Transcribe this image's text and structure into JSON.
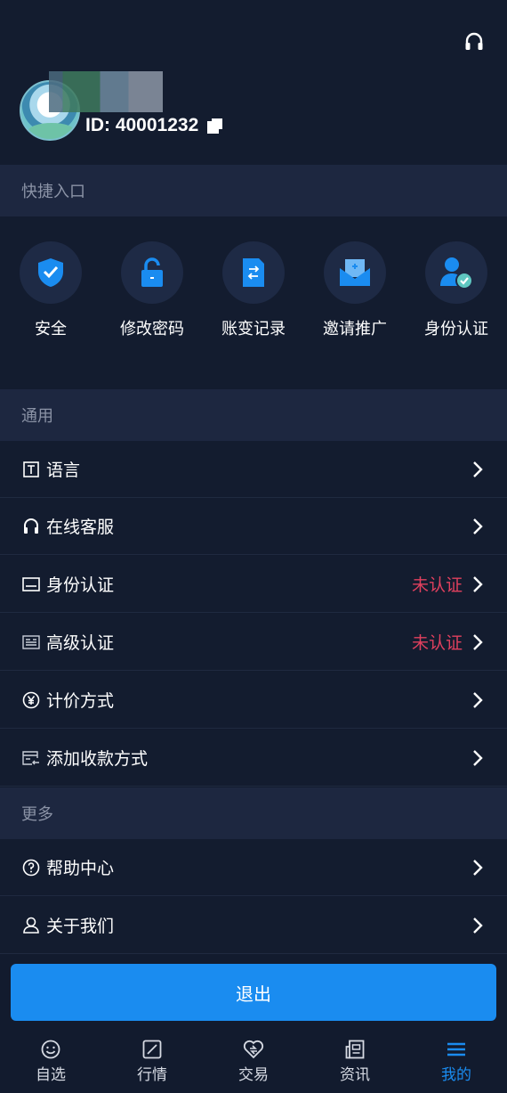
{
  "header": {
    "user_id": "ID:  40001232"
  },
  "sections": {
    "quick": "快捷入口",
    "general": "通用",
    "more": "更多"
  },
  "quick_items": [
    {
      "label": "安全",
      "icon": "shield-check-icon"
    },
    {
      "label": "修改密码",
      "icon": "lock-icon"
    },
    {
      "label": "账变记录",
      "icon": "document-transfer-icon"
    },
    {
      "label": "邀请推广",
      "icon": "envelope-icon"
    },
    {
      "label": "身份认证",
      "icon": "user-verified-icon"
    }
  ],
  "menu": {
    "language": "语言",
    "support": "在线客服",
    "identity": "身份认证",
    "identity_status": "未认证",
    "advanced": "高级认证",
    "advanced_status": "未认证",
    "pricing": "计价方式",
    "payment": "添加收款方式",
    "help": "帮助中心",
    "about": "关于我们"
  },
  "logout_label": "退出",
  "tabs": [
    {
      "label": "自选",
      "icon": "smile-icon"
    },
    {
      "label": "行情",
      "icon": "chart-icon"
    },
    {
      "label": "交易",
      "icon": "trade-heart-icon"
    },
    {
      "label": "资讯",
      "icon": "news-icon"
    },
    {
      "label": "我的",
      "icon": "menu-icon",
      "active": true
    }
  ],
  "colors": {
    "background": "#121b2e",
    "section_bg": "#1d2740",
    "accent": "#1a8cf0",
    "warning": "#e0405e"
  }
}
